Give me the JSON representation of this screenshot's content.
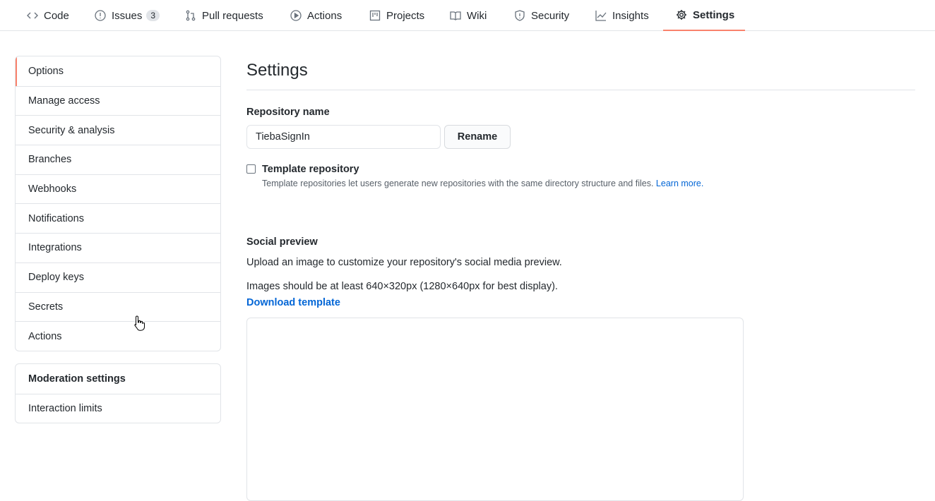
{
  "nav": {
    "tabs": [
      {
        "label": "Code",
        "icon": "code-icon"
      },
      {
        "label": "Issues",
        "icon": "issue-icon",
        "count": "3"
      },
      {
        "label": "Pull requests",
        "icon": "pull-request-icon"
      },
      {
        "label": "Actions",
        "icon": "play-icon"
      },
      {
        "label": "Projects",
        "icon": "project-icon"
      },
      {
        "label": "Wiki",
        "icon": "book-icon"
      },
      {
        "label": "Security",
        "icon": "shield-icon"
      },
      {
        "label": "Insights",
        "icon": "graph-icon"
      },
      {
        "label": "Settings",
        "icon": "gear-icon",
        "selected": true
      }
    ]
  },
  "sidebar": {
    "items": [
      "Options",
      "Manage access",
      "Security & analysis",
      "Branches",
      "Webhooks",
      "Notifications",
      "Integrations",
      "Deploy keys",
      "Secrets",
      "Actions"
    ],
    "moderation": {
      "header": "Moderation settings",
      "items": [
        "Interaction limits"
      ]
    }
  },
  "main": {
    "title": "Settings",
    "repo_name_label": "Repository name",
    "repo_name_value": "TiebaSignIn",
    "rename_label": "Rename",
    "template_label": "Template repository",
    "template_desc": "Template repositories let users generate new repositories with the same directory structure and files.",
    "learn_more": "Learn more.",
    "social_title": "Social preview",
    "social_desc": "Upload an image to customize your repository's social media preview.",
    "social_size": "Images should be at least 640×320px (1280×640px for best display).",
    "download_template": "Download template"
  },
  "colors": {
    "accent": "#f9826c",
    "link": "#0366d6"
  }
}
